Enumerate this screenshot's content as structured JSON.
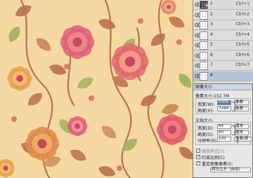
{
  "watermark": "www.huitu.com",
  "layers_panel": {
    "rows": [
      {
        "name": "1",
        "shortcut": "Ctrl+1",
        "thumb": "dark"
      },
      {
        "name": "2",
        "shortcut": "Ctrl+2",
        "thumb": "light"
      },
      {
        "name": "3",
        "shortcut": "Ctrl+3",
        "thumb": "light"
      },
      {
        "name": "4",
        "shortcut": "Ctrl+4",
        "thumb": "light"
      },
      {
        "name": "5",
        "shortcut": "Ctrl+5",
        "thumb": "light"
      },
      {
        "name": "6",
        "shortcut": "Ctrl+6",
        "thumb": "light"
      },
      {
        "name": "7",
        "shortcut": "Ctrl+7",
        "thumb": "light"
      },
      {
        "name": "8",
        "shortcut": "",
        "thumb": "light",
        "selected": true
      }
    ]
  },
  "image_size_dialog": {
    "title": "图像大小",
    "pixel_dimensions_label": "像素大小:152.7M",
    "width_label": "宽度(W):",
    "width_value": "5008",
    "height_label": "高度(H):",
    "height_value": "7299",
    "pixel_unit": "像素",
    "document_size_label": "文档大小:",
    "doc_width_label": "宽度(D):",
    "doc_width_value": "64",
    "doc_height_label": "高度(G):",
    "doc_height_value": "60",
    "resolution_label": "分辨率(R):",
    "resolution_value": "120",
    "doc_unit": "厘米",
    "resolution_unit": "像素/英寸",
    "scale_styles_label": "缩放样式(Y)",
    "constrain_label": "约束比例(C)",
    "resample_label": "重定图像像素(I):",
    "resample_method": "两次立方（自动）",
    "constrain_checked": true,
    "resample_checked": true
  }
}
